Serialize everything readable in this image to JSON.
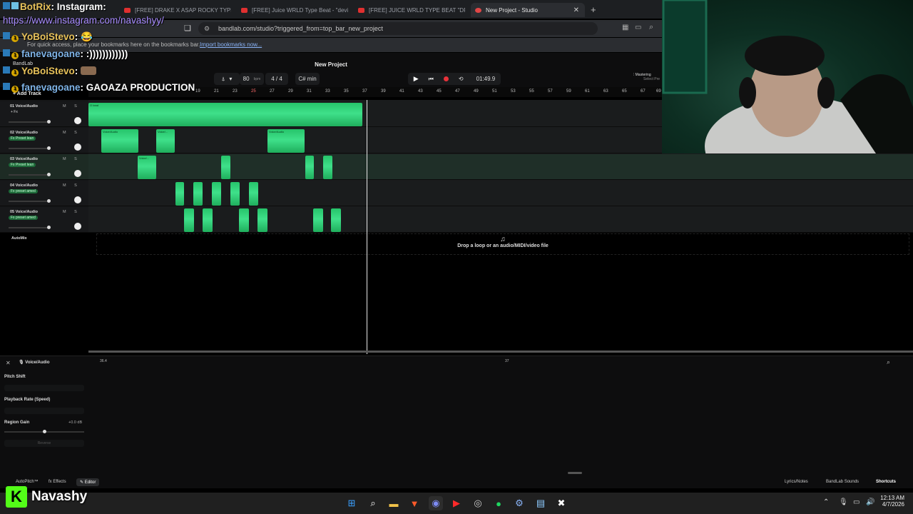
{
  "browser": {
    "tabs": [
      {
        "label": "[FREE] DRAKE X ASAP ROCKY TYPE B",
        "active": false
      },
      {
        "label": "[FREE] Juice WRLD Type Beat - \"devil",
        "active": false
      },
      {
        "label": "[FREE] JUICE WRLD TYPE BEAT \"DRU",
        "active": false
      },
      {
        "label": "New Project - Studio",
        "active": true
      }
    ],
    "new_tab": "+",
    "url": "bandlab.com/studio?triggered_from=top_bar_new_project",
    "bookmarks_hint": "For quick access, place your bookmarks here on the bookmarks bar.",
    "import_bookmarks": "Import bookmarks now..."
  },
  "studio": {
    "app_name": "BandLab",
    "project_title": "New Project",
    "add_track": "Add Track",
    "bpm": "80",
    "bpm_unit": "bpm",
    "time_sig": "4 / 4",
    "key": "C# min",
    "time_display": "01:49.9",
    "mastering_label": "Mastering",
    "mastering_sub": "Select Pre",
    "ruler_ticks": [
      "19",
      "21",
      "23",
      "25",
      "27",
      "29",
      "31",
      "33",
      "35",
      "37",
      "39",
      "41",
      "43",
      "45",
      "47",
      "49",
      "51",
      "53",
      "55",
      "57",
      "59",
      "61",
      "63",
      "65",
      "67",
      "69"
    ],
    "tracks": [
      {
        "name": "01  Voice/Audio",
        "fx": "+ Fx",
        "ms": "M S"
      },
      {
        "name": "02  Voice/Audio",
        "fx": "Fx Preset lean",
        "ms": "M S"
      },
      {
        "name": "03  Voice/Audio",
        "fx": "Fx Preset lean",
        "ms": "M S"
      },
      {
        "name": "04  Voice/Audio",
        "fx": "Fx preset amed",
        "ms": "M S"
      },
      {
        "name": "05  Voice/Audio",
        "fx": "Fx preset amed",
        "ms": "M S"
      }
    ],
    "clip_labels": {
      "beat": "O beat",
      "c1": "Voice/Audio",
      "c2": "Voice/...",
      "c3": "Voice/Audio",
      "c4": "Voice/..."
    },
    "automix": "AutoMix",
    "drop_text": "Drop a loop or an audio/MIDI/video file"
  },
  "editor": {
    "track_label": "Voice/Audio",
    "ruler_left": "36.4",
    "ruler_mid": "37",
    "pitch_shift": "Pitch Shift",
    "playback_rate": "Playback Rate (Speed)",
    "region_gain": "Region Gain",
    "region_gain_value": "+0.0 dB",
    "reverse": "Reverse"
  },
  "bottom_bar": {
    "autopitch": "AutoPitch™",
    "effects": "Effects",
    "editor": "Editor",
    "lyrics": "Lyrics/Notes",
    "sounds": "BandLab Sounds",
    "shortcuts": "Shortcuts"
  },
  "taskbar": {
    "time": "12:13 AM",
    "date": "4/7/2026",
    "icons": [
      "windows-icon",
      "search-icon",
      "folder-icon",
      "brave-icon",
      "discord-icon",
      "youtube-icon",
      "chrome-icon",
      "spotify-icon",
      "steam-icon",
      "notepad-icon",
      "capcut-icon"
    ]
  },
  "stream": {
    "chat": [
      {
        "user": "BotRix",
        "text": ": Instagram:"
      },
      {
        "user": "",
        "text": "https://www.instagram.com/navashyy/"
      },
      {
        "user": "YoBoiStevo",
        "text": ": 😂"
      },
      {
        "user": "fanevagoane",
        "text": ": :))))))))))))"
      },
      {
        "user": "YoBoiStevo",
        "text": ":"
      },
      {
        "user": "fanevagoane",
        "text": ": GAOAZA PRODUCTION"
      }
    ],
    "brand_logo": "K",
    "brand_name": "Navashy"
  },
  "colors": {
    "clip": "#2fd27a",
    "chat_user": "#e8c25a",
    "link": "#a88cff",
    "kick": "#53fc18"
  }
}
